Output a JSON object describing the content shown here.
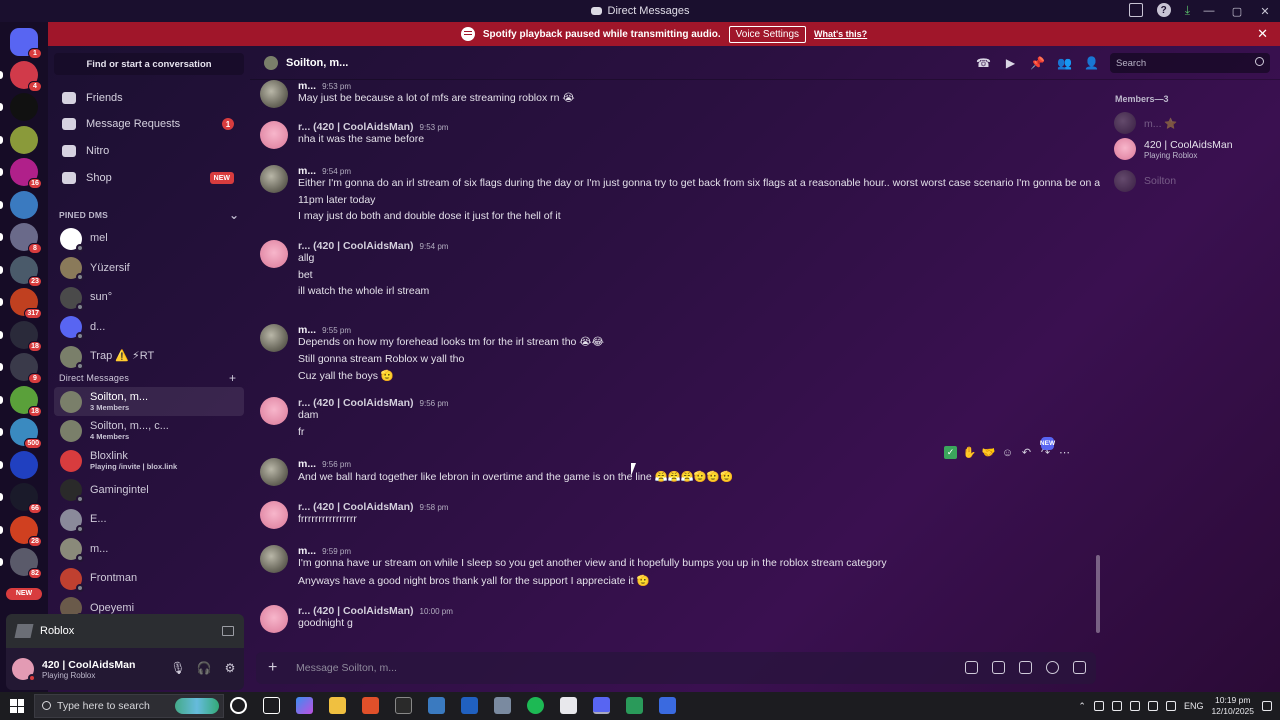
{
  "window": {
    "title": "Direct Messages"
  },
  "banner": {
    "text": "Spotify playback paused while transmitting audio.",
    "button": "Voice Settings",
    "link": "What's this?"
  },
  "guilds": [
    {
      "badge": "1",
      "color": "#5865f2"
    },
    {
      "badge": "4",
      "color": "#d13a4a"
    },
    {
      "badge": "",
      "color": "#111111"
    },
    {
      "badge": "",
      "color": "#8a9a3a"
    },
    {
      "badge": "16",
      "color": "#b0208a"
    },
    {
      "badge": "",
      "color": "#3a7ac0"
    },
    {
      "badge": "8",
      "color": "#6a6a8a"
    },
    {
      "badge": "23",
      "color": "#4a5a6a"
    },
    {
      "badge": "317",
      "color": "#c04020"
    },
    {
      "badge": "18",
      "color": "#2a2a3a"
    },
    {
      "badge": "9",
      "color": "#3a3a4a"
    },
    {
      "badge": "18",
      "color": "#5aa03a"
    },
    {
      "badge": "500",
      "color": "#3a8ac0"
    },
    {
      "badge": "",
      "color": "#2040c0"
    },
    {
      "badge": "66",
      "color": "#1a1a2a"
    },
    {
      "badge": "28",
      "color": "#d04020"
    },
    {
      "badge": "82",
      "color": "#5a5a6a"
    },
    {
      "badge": "NEW",
      "color": "#d83c3e"
    }
  ],
  "sidebar": {
    "find_placeholder": "Find or start a conversation",
    "nav": [
      {
        "label": "Friends",
        "badge": ""
      },
      {
        "label": "Message Requests",
        "badge": "1"
      },
      {
        "label": "Nitro",
        "badge": ""
      },
      {
        "label": "Shop",
        "badge": "NEW"
      }
    ],
    "pinned_header": "PINED DMS",
    "pinned": [
      {
        "name": "mel",
        "status": "offline",
        "color": "#ffffff"
      },
      {
        "name": "Yüzersif",
        "status": "offline",
        "color": "#8a7a5a"
      },
      {
        "name": "sun°",
        "status": "offline",
        "color": "#4a4a4a"
      },
      {
        "name": "d...",
        "status": "offline",
        "color": "#5865f2"
      },
      {
        "name": "Trap ⚠️ ⚡RT",
        "status": "offline",
        "color": "#7a7f6a"
      }
    ],
    "dm_header": "Direct Messages",
    "dms": [
      {
        "name": "Soilton, m...",
        "sub": "3 Members",
        "active": true,
        "color": "#7a7f6a"
      },
      {
        "name": "Soilton, m..., c...",
        "sub": "4 Members",
        "active": false,
        "color": "#7a7f6a"
      },
      {
        "name": "Bloxlink",
        "sub": "Playing /invite | blox.link",
        "active": false,
        "color": "#d83c3e"
      },
      {
        "name": "Gamingintel",
        "sub": "",
        "active": false,
        "color": "#2a2a2a"
      },
      {
        "name": "E...",
        "sub": "",
        "active": false,
        "color": "#8a8a9a"
      },
      {
        "name": "m...",
        "sub": "",
        "active": false,
        "color": "#8a8a7a"
      },
      {
        "name": "Frontman",
        "sub": "",
        "active": false,
        "color": "#c04030"
      },
      {
        "name": "Opeyemi",
        "sub": "",
        "active": false,
        "color": "#6a5a4a"
      }
    ]
  },
  "activity": {
    "label": "Roblox"
  },
  "user": {
    "name": "420 | CoolAidsMan",
    "status": "Playing Roblox"
  },
  "header": {
    "name": "Soilton, m...",
    "search_placeholder": "Search"
  },
  "messages": [
    {
      "author": "m...",
      "kind": "m",
      "time": "9:53 pm",
      "lines": [
        "May just be because a lot of mfs are streaming roblox rn 😭"
      ]
    },
    {
      "author": "r... (420 | CoolAidsMan)",
      "kind": "r",
      "time": "9:53 pm",
      "lines": [
        "nha it was the same before"
      ]
    },
    {
      "author": "m...",
      "kind": "m",
      "time": "9:54 pm",
      "lines": [
        "Either I'm gonna do an irl stream of six flags during the day or I'm just gonna try to get back from six flags at a reasonable hour.. worst worst case scenario I'm gonna be on at",
        "11pm later today",
        "I may just do both and double dose it just for the hell of it"
      ]
    },
    {
      "author": "r... (420 | CoolAidsMan)",
      "kind": "r",
      "time": "9:54 pm",
      "lines": [
        "allg",
        "bet",
        "ill watch the whole irl stream"
      ]
    },
    {
      "author": "m...",
      "kind": "m",
      "time": "9:55 pm",
      "lines": [
        "Depends on how my forehead looks tm for the irl stream tho 😭😂",
        "Still gonna stream Roblox w yall tho",
        "Cuz yall the boys 🫡"
      ]
    },
    {
      "author": "r... (420 | CoolAidsMan)",
      "kind": "r",
      "time": "9:56 pm",
      "lines": [
        "dam",
        "fr"
      ]
    },
    {
      "author": "m...",
      "kind": "m",
      "time": "9:56 pm",
      "lines": [
        "And we ball hard together like lebron in overtime and the game is on the line 😤😤😤🫡🫡🫡"
      ]
    },
    {
      "author": "r... (420 | CoolAidsMan)",
      "kind": "r",
      "time": "9:58 pm",
      "lines": [
        "frrrrrrrrrrrrrrrr"
      ]
    },
    {
      "author": "m...",
      "kind": "m",
      "time": "9:59 pm",
      "lines": [
        "I'm gonna have ur stream on while I sleep so you get another view and it hopefully bumps you up in the roblox stream category",
        "Anyways have a good night bros thank yall for the support I appreciate it 🫡"
      ]
    },
    {
      "author": "r... (420 | CoolAidsMan)",
      "kind": "r",
      "time": "10:00 pm",
      "lines": [
        "goodnight g"
      ]
    }
  ],
  "toolbar": {
    "new_badge": "NEW"
  },
  "composer": {
    "placeholder": "Message Soilton, m..."
  },
  "members": {
    "header": "Members—3",
    "list": [
      {
        "name": "m... ⭐",
        "sub": "",
        "dim": true,
        "kind": "m"
      },
      {
        "name": "420 | CoolAidsMan",
        "sub": "Playing Roblox",
        "dim": false,
        "kind": "r"
      },
      {
        "name": "Soilton",
        "sub": "",
        "dim": true,
        "kind": "m"
      }
    ]
  },
  "taskbar": {
    "search_placeholder": "Type here to search",
    "lang": "ENG",
    "time": "10:19 pm",
    "date": "12/10/2025"
  }
}
